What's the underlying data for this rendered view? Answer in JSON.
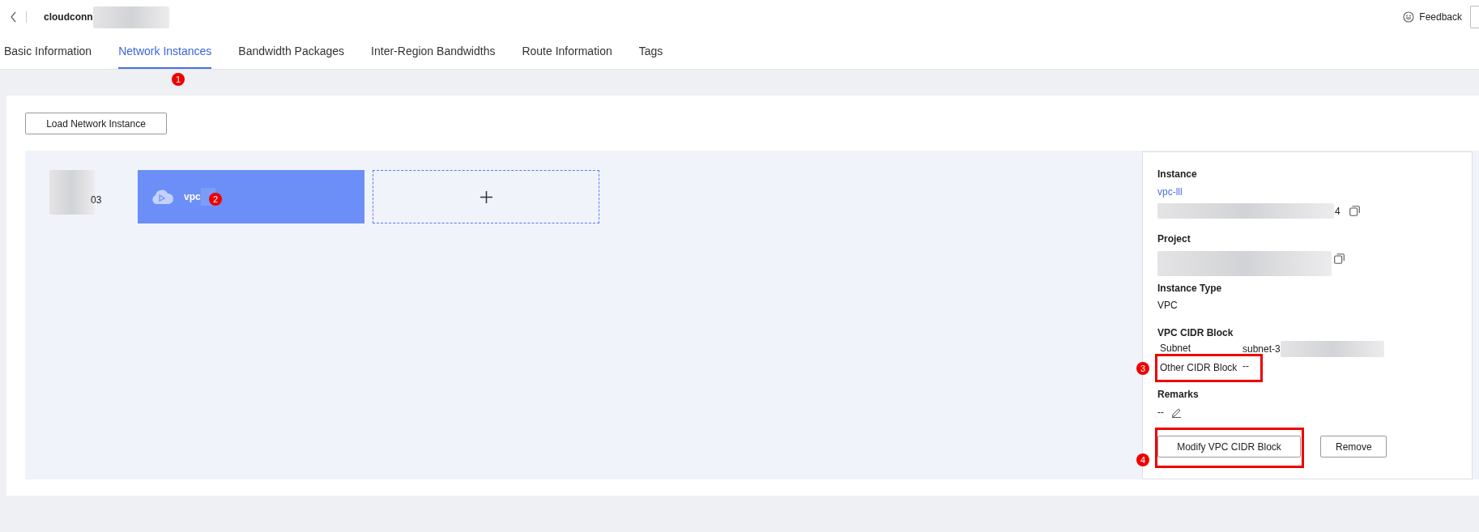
{
  "header": {
    "title": "cloudconn",
    "feedback": "Feedback"
  },
  "tabs": [
    {
      "label": "Basic Information",
      "selected": false
    },
    {
      "label": "Network Instances",
      "selected": true,
      "badge": "1"
    },
    {
      "label": "Bandwidth Packages",
      "selected": false
    },
    {
      "label": "Inter-Region Bandwidths",
      "selected": false
    },
    {
      "label": "Route Information",
      "selected": false
    },
    {
      "label": "Tags",
      "selected": false
    }
  ],
  "load_button": "Load Network Instance",
  "canvas": {
    "region_suffix": "03",
    "node": {
      "label": "vpc",
      "badge": "2",
      "selected": true
    }
  },
  "details": {
    "instance": {
      "label": "Instance",
      "name": "vpc-lll",
      "id_suffix": "4"
    },
    "project": {
      "label": "Project"
    },
    "instance_type": {
      "label": "Instance Type",
      "value": "VPC"
    },
    "cidr": {
      "label": "VPC CIDR Block",
      "rows": [
        {
          "label": "Subnet",
          "value": "subnet-3",
          "highlighted": false
        },
        {
          "label": "Other CIDR Block",
          "value": "--",
          "highlighted": true,
          "badge": "3"
        }
      ]
    },
    "remarks": {
      "label": "Remarks",
      "value": "--"
    },
    "buttons": [
      {
        "label": "Modify VPC CIDR Block",
        "highlighted": true,
        "badge": "4"
      },
      {
        "label": "Remove",
        "highlighted": false
      }
    ]
  }
}
